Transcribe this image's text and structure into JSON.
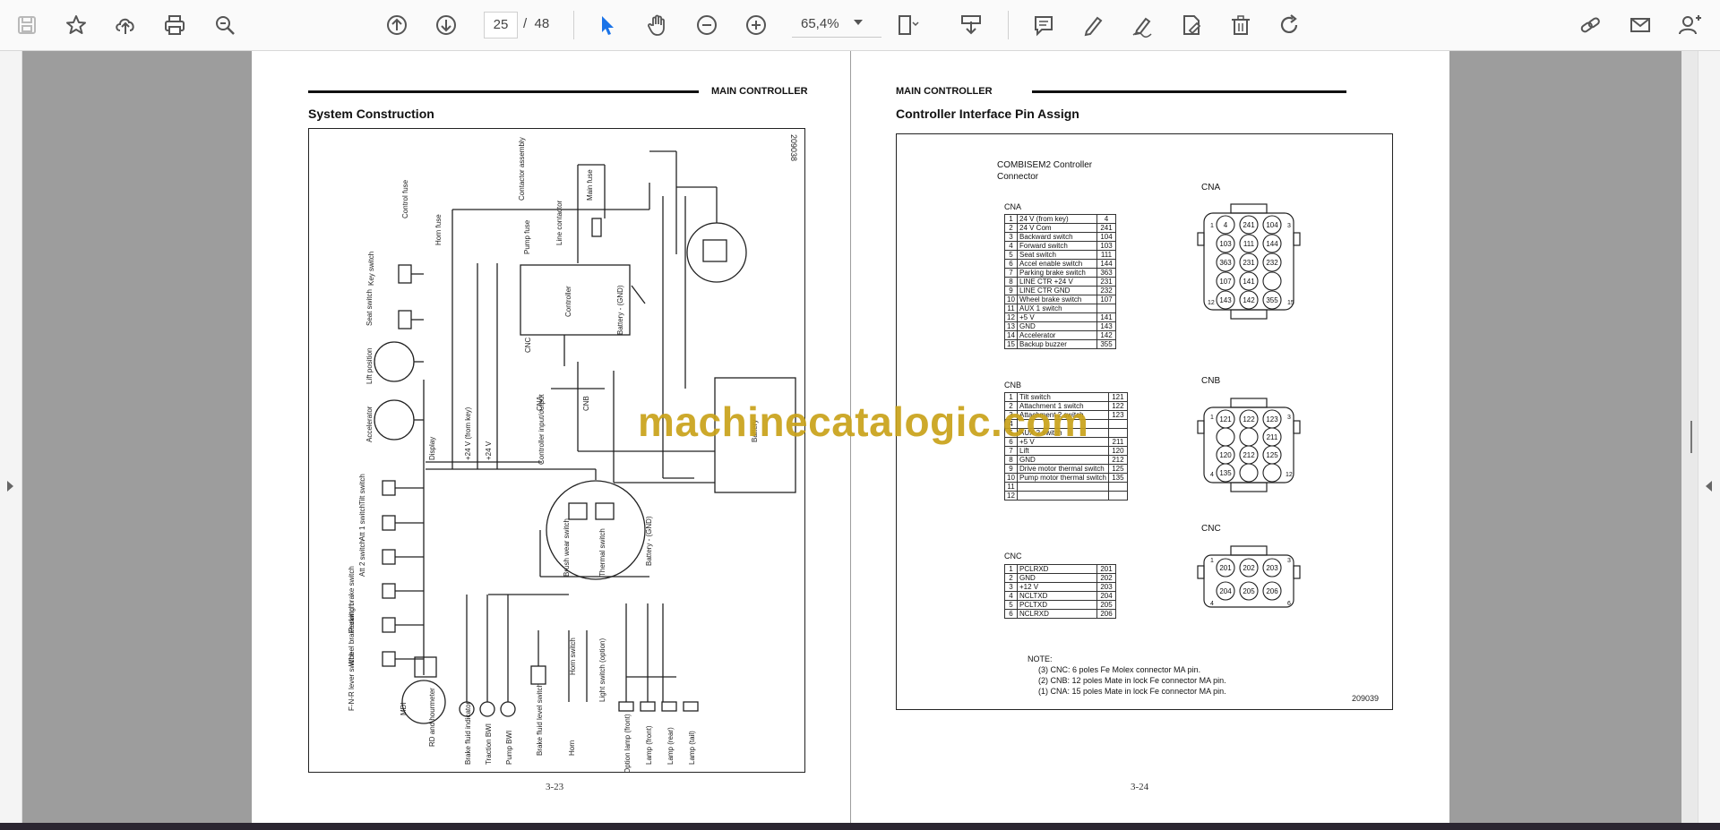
{
  "toolbar": {
    "page_current": "25",
    "page_separator": "/",
    "page_total": "48",
    "zoom": "65,4%",
    "icons": [
      "save-icon",
      "bookmark-star-icon",
      "upload-cloud-icon",
      "print-icon",
      "zoom-search-icon",
      "prev-page-icon",
      "next-page-icon",
      "select-cursor-icon",
      "hand-tool-icon",
      "zoom-out-icon",
      "zoom-in-icon",
      "fit-page-icon",
      "download-tray-icon",
      "comment-icon",
      "highlight-pen-icon",
      "sign-pen-icon",
      "edit-doc-icon",
      "delete-icon",
      "redo-icon",
      "share-link-icon",
      "mail-icon",
      "add-user-icon"
    ]
  },
  "colors": {
    "accent": "#1a73e8",
    "watermark": "#c9a21a",
    "viewer_bg": "#9d9d9d"
  },
  "watermark": "machinecatalogic.com",
  "left_page": {
    "header": "MAIN CONTROLLER",
    "title": "System Construction",
    "figure_number": "209038",
    "page_number": "3-23",
    "labels": {
      "key_switch": "Key switch",
      "control_fuse": "Control fuse",
      "horn_fuse": "Horn fuse",
      "contactor_assembly": "Contactor assembly",
      "main_fuse": "Main fuse",
      "pump_fuse": "Pump fuse",
      "line_contactor": "Line contactor",
      "seat_switch": "Seat switch",
      "lift_position": "Lift position",
      "accelerator": "Accelerator",
      "controller": "Controller",
      "battery_gnd": "Battery - (GND)",
      "cnc": "CNC",
      "cna": "CNA",
      "cnb": "CNB",
      "display": "Display",
      "v24_from_key": "+24 V (from key)",
      "v24": "+24 V",
      "controller_input_output": "Controller input/output",
      "battery": "Battery",
      "tilt_switch": "Tilt switch",
      "att1_switch": "Att 1 switch",
      "att2_switch": "Att 2 switch",
      "parking_brake_switch": "Parking brake switch",
      "wheel_brake_switch": "Wheel brake switch",
      "fnr_lever_switch": "F-N-R lever switch",
      "brush_wear_switch": "Brush wear switch",
      "thermal_switch": "Thermal switch",
      "battery_gnd2": "Battery - (GND)",
      "mdi": "MDI",
      "rd_hourmeter": "RD and hourmeter",
      "brake_fluid_indicator": "Brake fluid indicator",
      "traction_bwi": "Traction BWI",
      "pump_bwi": "Pump BWI",
      "brake_fluid_level_switch": "Brake fluid level switch",
      "horn_switch": "Horn switch",
      "light_switch": "Light switch (option)",
      "horn": "Horn",
      "lamps": [
        "Option lamp (front)",
        "Lamp (front)",
        "Lamp (rear)",
        "Lamp (tail)"
      ]
    }
  },
  "right_page": {
    "header": "MAIN CONTROLLER",
    "title": "Controller Interface Pin Assign",
    "figure_number": "209039",
    "page_number": "3-24",
    "combi_title_line1": "COMBISEM2 Controller",
    "combi_title_line2": "Connector",
    "cna": {
      "caption": "CNA",
      "rows": [
        [
          "1",
          "24 V (from key)",
          "4"
        ],
        [
          "2",
          "24 V Com",
          "241"
        ],
        [
          "3",
          "Backward switch",
          "104"
        ],
        [
          "4",
          "Forward switch",
          "103"
        ],
        [
          "5",
          "Seat switch",
          "111"
        ],
        [
          "6",
          "Accel enable switch",
          "144"
        ],
        [
          "7",
          "Parking brake switch",
          "363"
        ],
        [
          "8",
          "LINE CTR +24 V",
          "231"
        ],
        [
          "9",
          "LINE CTR GND",
          "232"
        ],
        [
          "10",
          "Wheel brake switch",
          "107"
        ],
        [
          "11",
          "AUX 1 switch",
          ""
        ],
        [
          "12",
          "+5 V",
          "141"
        ],
        [
          "13",
          "GND",
          "143"
        ],
        [
          "14",
          "Accelerator",
          "142"
        ],
        [
          "15",
          "Backup buzzer",
          "355"
        ]
      ]
    },
    "cnb": {
      "caption": "CNB",
      "rows": [
        [
          "1",
          "Tilt switch",
          "121"
        ],
        [
          "2",
          "Attachment 1 switch",
          "122"
        ],
        [
          "3",
          "Attachment 2 switch",
          "123"
        ],
        [
          "4",
          "",
          ""
        ],
        [
          "5",
          "AUX 2 switch",
          ""
        ],
        [
          "6",
          "+5 V",
          "211"
        ],
        [
          "7",
          "Lift",
          "120"
        ],
        [
          "8",
          "GND",
          "212"
        ],
        [
          "9",
          "Drive motor thermal switch",
          "125"
        ],
        [
          "10",
          "Pump motor thermal switch",
          "135"
        ],
        [
          "11",
          "",
          ""
        ],
        [
          "12",
          "",
          ""
        ]
      ]
    },
    "cnc": {
      "caption": "CNC",
      "rows": [
        [
          "1",
          "PCLRXD",
          "201"
        ],
        [
          "2",
          "GND",
          "202"
        ],
        [
          "3",
          "+12 V",
          "203"
        ],
        [
          "4",
          "NCLTXD",
          "204"
        ],
        [
          "5",
          "PCLTXD",
          "205"
        ],
        [
          "6",
          "NCLRXD",
          "206"
        ]
      ]
    },
    "connector_labels": {
      "cna": "CNA",
      "cnb": "CNB",
      "cnc": "CNC",
      "cna_pins": [
        "4",
        "241",
        "104",
        "103",
        "111",
        "144",
        "363",
        "231",
        "232",
        "107",
        "141",
        "143",
        "142",
        "355"
      ],
      "cna_corner": [
        "1",
        "3",
        "12",
        "15"
      ],
      "cnb_pins": [
        "121",
        "122",
        "123",
        "211",
        "120",
        "212",
        "125",
        "135"
      ],
      "cnb_corner": [
        "1",
        "3",
        "4",
        "12"
      ],
      "cnc_pins": [
        "201",
        "202",
        "203",
        "204",
        "205",
        "206"
      ],
      "cnc_corner": [
        "1",
        "3",
        "4",
        "6"
      ]
    },
    "notes": {
      "title": "NOTE:",
      "items": [
        "(3)  CNC:  6 poles Fe Molex connector MA pin.",
        "(2)  CNB:  12 poles Mate in lock Fe connector MA pin.",
        "(1)  CNA:  15 poles Mate in lock Fe connector MA pin."
      ]
    }
  }
}
